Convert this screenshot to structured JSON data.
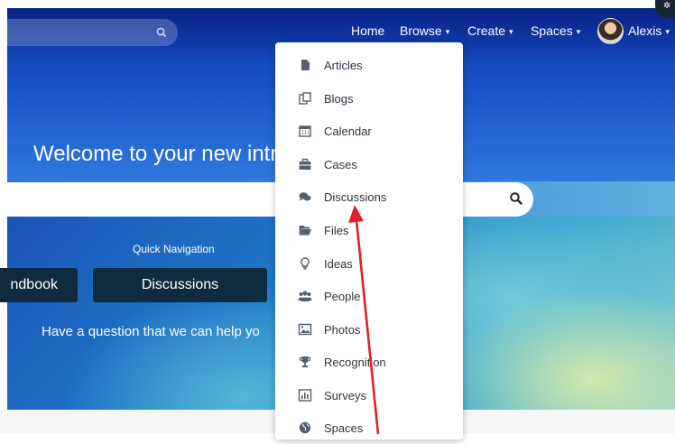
{
  "header": {
    "nav": [
      {
        "label": "Home",
        "has_caret": false
      },
      {
        "label": "Browse",
        "has_caret": true
      },
      {
        "label": "Create",
        "has_caret": true
      },
      {
        "label": "Spaces",
        "has_caret": true
      },
      {
        "label": "Alexis",
        "has_caret": true
      }
    ],
    "caret_glyph": "▾",
    "corner_glyph": "✲"
  },
  "hero": {
    "welcome_text": "Welcome to your new intr"
  },
  "quick_navigation": {
    "label": "Quick Navigation",
    "buttons": [
      "ndbook",
      "Discussions"
    ]
  },
  "question_text": "Have a question that we can help yo",
  "browse_menu": {
    "items": [
      {
        "label": "Articles",
        "icon": "document-icon"
      },
      {
        "label": "Blogs",
        "icon": "blogs-icon"
      },
      {
        "label": "Calendar",
        "icon": "calendar-icon"
      },
      {
        "label": "Cases",
        "icon": "briefcase-icon"
      },
      {
        "label": "Discussions",
        "icon": "chat-bubbles-icon"
      },
      {
        "label": "Files",
        "icon": "folder-open-icon"
      },
      {
        "label": "Ideas",
        "icon": "lightbulb-icon"
      },
      {
        "label": "People",
        "icon": "people-icon"
      },
      {
        "label": "Photos",
        "icon": "image-icon"
      },
      {
        "label": "Recognition",
        "icon": "trophy-icon"
      },
      {
        "label": "Surveys",
        "icon": "bar-chart-icon"
      },
      {
        "label": "Spaces",
        "icon": "globe-icon"
      }
    ]
  },
  "colors": {
    "hero_top": "#0d35a6",
    "menu_text": "#2b3340",
    "menu_icon": "#55606e",
    "button_bg": "#0f2b3d",
    "arrow": "#e0202a"
  }
}
